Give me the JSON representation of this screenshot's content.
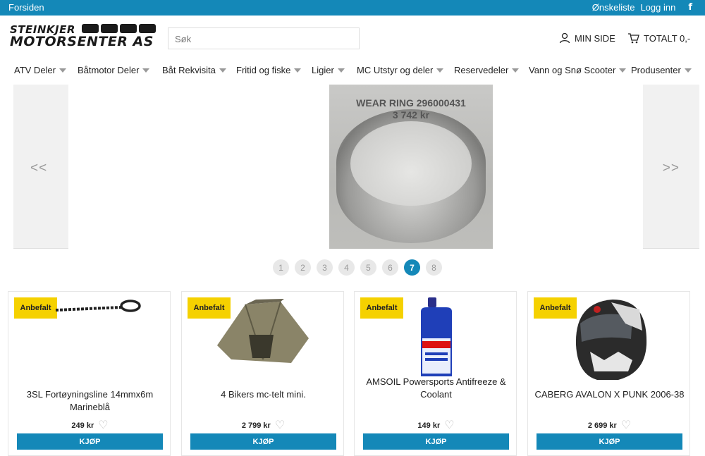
{
  "topbar": {
    "home": "Forsiden",
    "wishlist": "Ønskeliste",
    "login": "Logg inn",
    "facebook_glyph": "f"
  },
  "header": {
    "logo_line1": "STEINKJER",
    "logo_line2": "MOTORSENTER AS",
    "search_placeholder": "Søk",
    "minside": "MIN SIDE",
    "cart": "TOTALT 0,-"
  },
  "nav": [
    {
      "label": "ATV Deler"
    },
    {
      "label": "Båtmotor Deler"
    },
    {
      "label": "Båt Rekvisita"
    },
    {
      "label": "Fritid og fiske"
    },
    {
      "label": "Ligier"
    },
    {
      "label": "MC Utstyr og deler"
    },
    {
      "label": "Reservedeler"
    },
    {
      "label": "Vann og Snø Scooter"
    },
    {
      "label": "Produsenter"
    }
  ],
  "slider": {
    "prev": "<<",
    "next": ">>",
    "title": "WEAR RING 296000431",
    "price": "3 742 kr"
  },
  "pagination": {
    "pages": [
      "1",
      "2",
      "3",
      "4",
      "5",
      "6",
      "7",
      "8"
    ],
    "active": "7"
  },
  "products": [
    {
      "badge": "Anbefalt",
      "name": "3SL Fortøyningsline 14mmx6m Marineblå",
      "price": "249 kr",
      "buy": "KJØP",
      "icon": "rope-image"
    },
    {
      "badge": "Anbefalt",
      "name": "4 Bikers mc-telt mini.",
      "price": "2 799 kr",
      "buy": "KJØP",
      "icon": "tent-image"
    },
    {
      "badge": "Anbefalt",
      "name": "AMSOIL Powersports Antifreeze & Coolant",
      "price": "149 kr",
      "buy": "KJØP",
      "icon": "bottle-image"
    },
    {
      "badge": "Anbefalt",
      "name": "CABERG AVALON X PUNK 2006-38",
      "price": "2 699 kr",
      "buy": "KJØP",
      "icon": "helmet-image"
    }
  ],
  "colors": {
    "brand": "#1488b8",
    "badge": "#f5d100"
  }
}
